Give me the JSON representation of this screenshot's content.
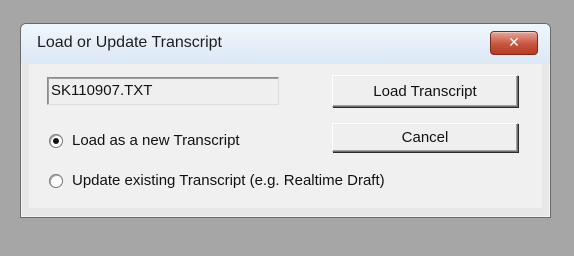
{
  "window": {
    "title": "Load or Update Transcript",
    "close_symbol": "✕"
  },
  "file_field": {
    "value": "SK110907.TXT"
  },
  "buttons": {
    "load_label": "Load Transcript",
    "cancel_label": "Cancel"
  },
  "options": [
    {
      "label": "Load as a new Transcript",
      "selected": true
    },
    {
      "label": "Update existing Transcript (e.g. Realtime Draft)",
      "selected": false
    }
  ],
  "colors": {
    "close_button": "#c9543e",
    "dialog_background": "#f0f0f0",
    "desktop": "#a6a6a6"
  }
}
